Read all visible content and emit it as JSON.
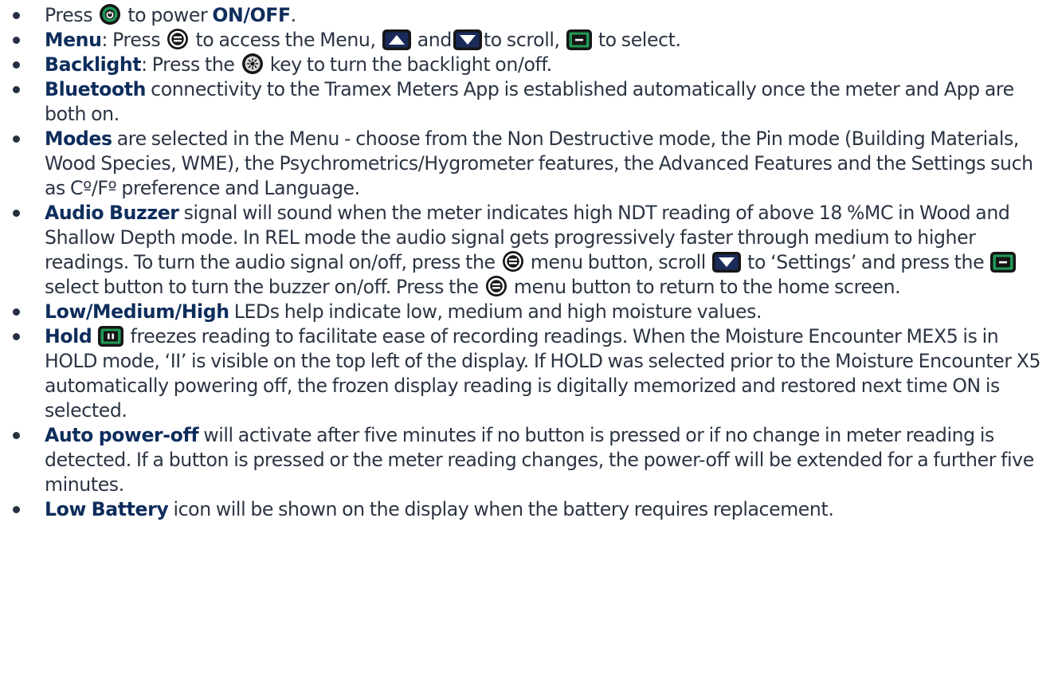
{
  "items": [
    {
      "power_pre": "Press",
      "power_post": " to power ",
      "power_kw": "ON/OFF",
      "power_end": "."
    },
    {
      "menu_kw": "Menu",
      "menu_t1": ": Press",
      "menu_t2": " to access the Menu, ",
      "menu_t3": " and",
      "menu_t4": "to scroll, ",
      "menu_t5": " to select."
    },
    {
      "back_kw": "Backlight",
      "back_t1": ": Press the ",
      "back_t2": " key to turn the backlight on/off."
    },
    {
      "bt_kw": "Bluetooth",
      "bt_t1": " connectivity to the Tramex Meters App is established automatically once the meter and App are both on."
    },
    {
      "modes_kw": "Modes",
      "modes_t1": " are selected in the Menu - choose from the Non Destructive mode, the Pin mode (Building Materials, Wood Species, WME), the Psychrometrics/Hygrometer features, the Advanced Features and the Settings such as Cº/Fº preference and Language."
    },
    {
      "audio_kw": "Audio Buzzer",
      "audio_t1": " signal will sound when the meter indicates high NDT reading of above 18 %MC in Wood and Shallow Depth mode. In REL mode the audio signal gets progressively faster through medium to higher readings. To turn the audio signal on/off, press the ",
      "audio_t2": " menu button, scroll ",
      "audio_t3": " to ‘Settings’ and press the ",
      "audio_t4": " select button to turn the buzzer on/off. Press the ",
      "audio_t5": " menu button to return to the home screen."
    },
    {
      "leds_kw": "Low/Medium/High",
      "leds_t1": " LEDs help indicate low, medium and high moisture values."
    },
    {
      "hold_kw": "Hold",
      "hold_t1": " freezes reading to facilitate ease of recording readings. When the Moisture Encounter MEX5 is in HOLD mode, ‘II’ is visible on the top left of the display. If HOLD was selected prior to the Moisture Encounter X5 automatically powering off, the frozen display reading is digitally memorized and restored next time ON is selected."
    },
    {
      "auto_kw": "Auto power-off",
      "auto_t1": " will activate after five minutes if no button is pressed or if no change in meter reading is detected. If a button is pressed or the meter reading changes, the power-off will be extended for a further five minutes."
    },
    {
      "batt_kw": "Low Battery",
      "batt_t1": " icon will be shown on the display when the battery requires replacement."
    }
  ],
  "icons": {
    "power": "power-button-icon",
    "menu": "menu-button-icon",
    "up": "up-arrow-button-icon",
    "down": "down-arrow-button-icon",
    "select": "select-button-icon",
    "backlight": "backlight-button-icon",
    "hold": "hold-button-icon"
  },
  "colors": {
    "keyword": "#0e2d5c",
    "icon_green": "#1f9a57",
    "icon_blue": "#1a2a5a",
    "icon_dark": "#161616"
  }
}
